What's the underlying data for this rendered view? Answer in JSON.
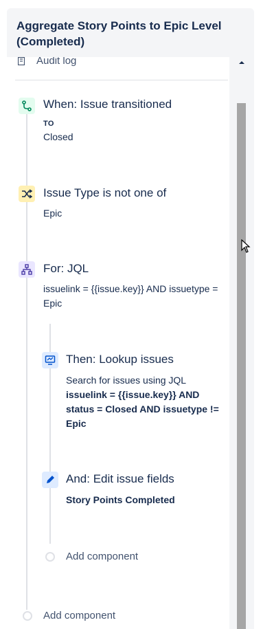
{
  "header": {
    "title": "Aggregate Story Points to Epic Level (Completed)"
  },
  "audit": {
    "label": "Audit log",
    "icon": "audit-log-icon"
  },
  "trigger": {
    "icon": "branch-transition-icon",
    "title": "When: Issue transitioned",
    "to_label": "TO",
    "to_value": "Closed",
    "accent": "#e3fcef"
  },
  "condition": {
    "icon": "shuffle-icon",
    "title": "Issue Type is not one of",
    "value": "Epic",
    "accent": "#fff0b3"
  },
  "branch": {
    "icon": "hierarchy-icon",
    "title": "For: JQL",
    "jql": "issuelink = {{issue.key}} AND issuetype = Epic",
    "accent": "#eae6ff"
  },
  "lookup": {
    "icon": "monitor-icon",
    "title": "Then: Lookup issues",
    "desc": "Search for issues using JQL",
    "jql": "issuelink = {{issue.key}} AND status = Closed AND issuetype != Epic",
    "accent": "#deebff"
  },
  "edit": {
    "icon": "pencil-icon",
    "title": "And: Edit issue fields",
    "field": "Story Points Completed",
    "accent": "#deebff"
  },
  "add_inner": {
    "label": "Add component"
  },
  "add_outer": {
    "label": "Add component"
  }
}
